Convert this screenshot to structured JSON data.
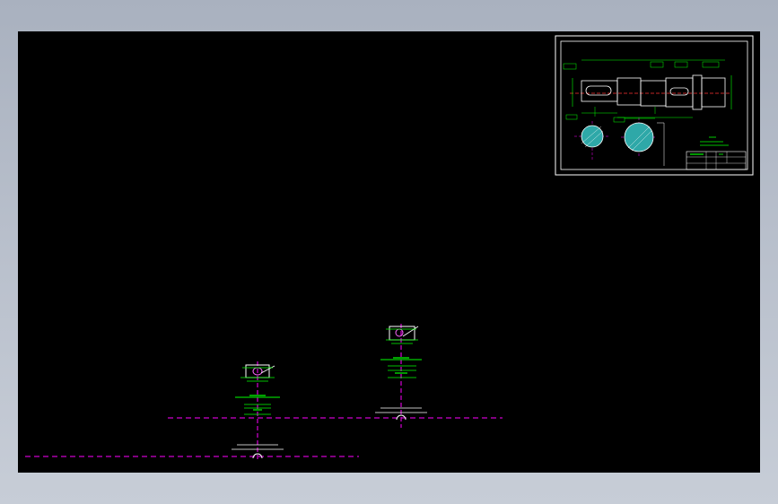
{
  "window": {
    "title": ""
  },
  "viewport": {
    "background": "#000000",
    "colors": {
      "frame": "#ffffff",
      "geometry": "#00ff00",
      "centerline": "#ff00ff",
      "hatch": "#2ea8a8",
      "dimension": "#ffffff"
    }
  },
  "drawing_sheet": {
    "notes": [
      "",
      ""
    ]
  },
  "icons": [
    "shaft-drawing-sheet",
    "section-view-icon"
  ]
}
